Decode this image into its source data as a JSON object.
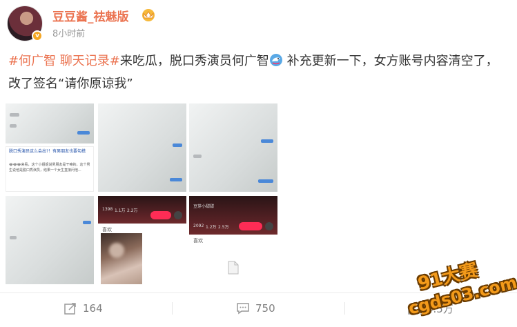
{
  "author": {
    "name": "豆豆酱_祛魅版",
    "verified_icon": "v-badge",
    "badge_icon": "crown-icon",
    "verified_mark": "v"
  },
  "post": {
    "time": "8小时前",
    "hashtag1": "#何广智 聊天记录#",
    "text1": "来吃瓜，脱口秀演员何广智",
    "emoji": "dolphin-emoji-icon",
    "text2": " 补充更新一下，女方账号内容清空了，改了签名“请你原谅我”"
  },
  "images": {
    "count": 9,
    "thumb4": {
      "title": "脱口秀演员这么会出?！有男朋友也要勾搭",
      "body": "😂😂😂来看，这个小姐姐说男朋友是干嘛的。这个男生说他是脱口秀演员，结果一个女生直接问他..."
    },
    "thumb8": {
      "stats": [
        "1398",
        "1.1万",
        "2.2万"
      ],
      "tab": "喜欢"
    },
    "thumb9": {
      "name": "豆芽小甜甜",
      "stats": [
        "2092",
        "1.2万",
        "2.5万"
      ],
      "tab": "喜欢"
    }
  },
  "actions": {
    "repost": "164",
    "comment": "750",
    "like": "4.5万"
  },
  "watermark": {
    "line1": "91大赛",
    "line2": "cgds03.com"
  },
  "colors": {
    "accent": "#eb7350",
    "muted": "#999999"
  }
}
